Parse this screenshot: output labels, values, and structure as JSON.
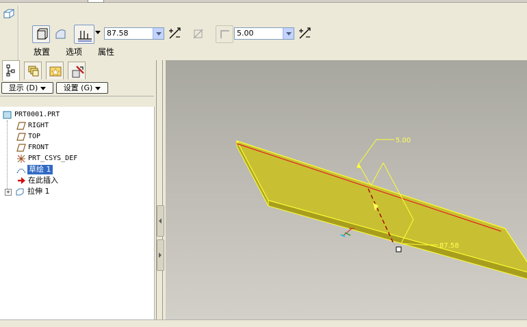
{
  "dashboard": {
    "depth_value": "87.58",
    "thickness_value": "5.00",
    "tabs": [
      {
        "label": "放置"
      },
      {
        "label": "选项"
      },
      {
        "label": "属性"
      }
    ],
    "icons": {
      "feature": "extrude-feature-icon",
      "solid": "solid-extrude-icon",
      "surface": "surface-extrude-icon",
      "depth_option": "blind-depth-icon",
      "flip_depth": "flip-direction-icon",
      "remove_material": "remove-material-icon",
      "thicken": "thicken-sketch-icon",
      "flip_thickness": "flip-thickness-icon"
    }
  },
  "panel": {
    "tabs": [
      {
        "name": "model-tree-tab-icon"
      },
      {
        "name": "layers-tab-icon"
      },
      {
        "name": "favorites-tab-icon"
      },
      {
        "name": "tools-tab-icon"
      }
    ],
    "menus": {
      "show": "显示 (D)",
      "settings": "设置 (G)"
    }
  },
  "tree": {
    "root": "PRT0001.PRT",
    "items": [
      {
        "label": "RIGHT",
        "icon": "datum-plane-icon"
      },
      {
        "label": "TOP",
        "icon": "datum-plane-icon"
      },
      {
        "label": "FRONT",
        "icon": "datum-plane-icon"
      },
      {
        "label": "PRT_CSYS_DEF",
        "icon": "coordinate-system-icon"
      },
      {
        "label": "草绘 1",
        "icon": "sketch-icon",
        "selected": true
      },
      {
        "label": "在此插入",
        "icon": "insert-here-arrow-icon"
      },
      {
        "label": "拉伸 1",
        "icon": "extrude-feature-icon"
      }
    ]
  },
  "viewport": {
    "thickness_dim": "5.00",
    "depth_dim": "87.58",
    "colors": {
      "preview_fill": "#c8c032",
      "preview_edge": "#ffff33",
      "sketch_line": "#e02020",
      "background_top": "#a8a79f",
      "background_bottom": "#d2d0c8"
    }
  }
}
